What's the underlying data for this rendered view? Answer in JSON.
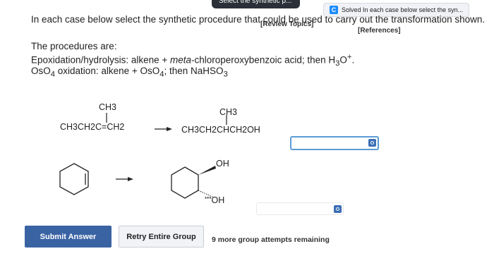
{
  "browser": {
    "tab_left_title": "Select the synthetic p...",
    "tab_right_icon": "C",
    "tab_right_title": "Solved In each case below select the syn..."
  },
  "links": {
    "review_topics": "[Review Topics]",
    "references": "[References]"
  },
  "question": "In each case below select the synthetic procedure that could be used to carry out the transformation shown.",
  "procedures": {
    "heading": "The procedures are:",
    "p1_a": "Epoxidation/hydrolysis: alkene + ",
    "p1_b": "meta",
    "p1_c": "-chloroperoxybenzoic acid; then H",
    "p1_sub": "3",
    "p1_d": "O",
    "p1_sup": "+",
    "p1_e": ".",
    "p2_a": "OsO",
    "p2_sub1": "4",
    "p2_b": " oxidation: alkene + OsO",
    "p2_sub2": "4",
    "p2_c": "; then NaHSO",
    "p2_sub3": "3"
  },
  "reaction1": {
    "reactant_top": "CH3",
    "reactant_main": "CH3CH2C=CH2",
    "product_top": "CH3",
    "product_main": "CH3CH2CHCH2OH"
  },
  "reaction2": {
    "oh_top": "OH",
    "oh_bottom": "''''OH"
  },
  "buttons": {
    "submit": "Submit Answer",
    "retry": "Retry Entire Group"
  },
  "status": {
    "attempts": "9 more group attempts remaining"
  }
}
